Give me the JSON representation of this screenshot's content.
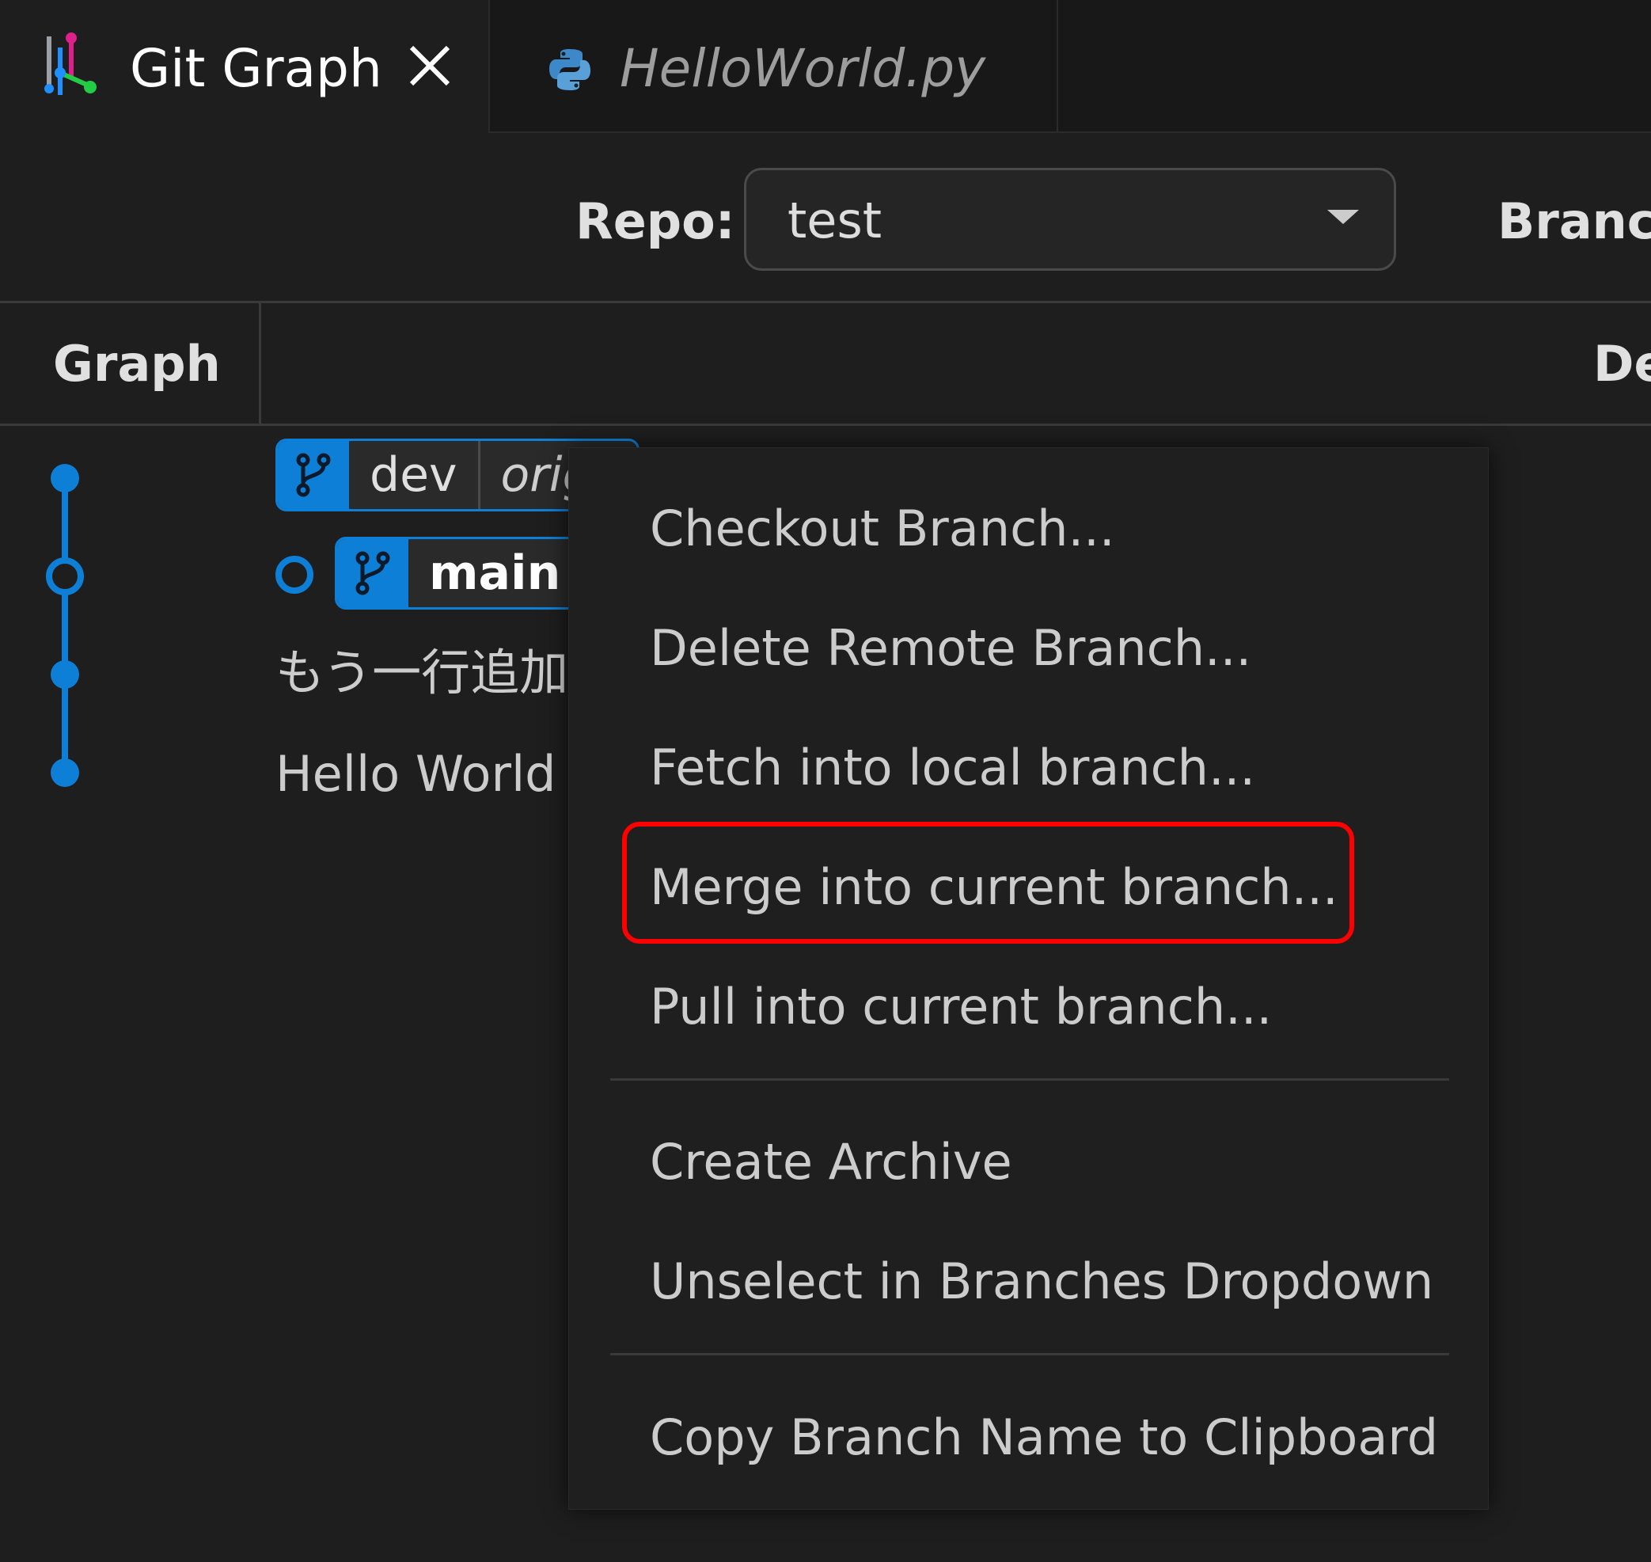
{
  "tabs": [
    {
      "title": "Git Graph",
      "active": true,
      "icon": "git-graph-icon"
    },
    {
      "title": "HelloWorld.py",
      "active": false,
      "icon": "python-icon"
    }
  ],
  "controls": {
    "repo_label": "Repo:",
    "repo_value": "test",
    "branches_label": "Branc"
  },
  "table": {
    "graph_header": "Graph",
    "description_header": "De"
  },
  "commits": {
    "dev_branch": "dev",
    "dev_remote": "orig",
    "main_branch": "main",
    "msg_1": "もう一行追加",
    "msg_2": "Hello World"
  },
  "menu": {
    "items": [
      "Checkout Branch...",
      "Delete Remote Branch...",
      "Fetch into local branch...",
      "Merge into current branch...",
      "Pull into current branch...",
      "Create Archive",
      "Unselect in Branches Dropdown",
      "Copy Branch Name to Clipboard"
    ]
  },
  "colors": {
    "accent": "#0e7fd6",
    "highlight": "#ff0000",
    "background": "#1e1e1e"
  }
}
